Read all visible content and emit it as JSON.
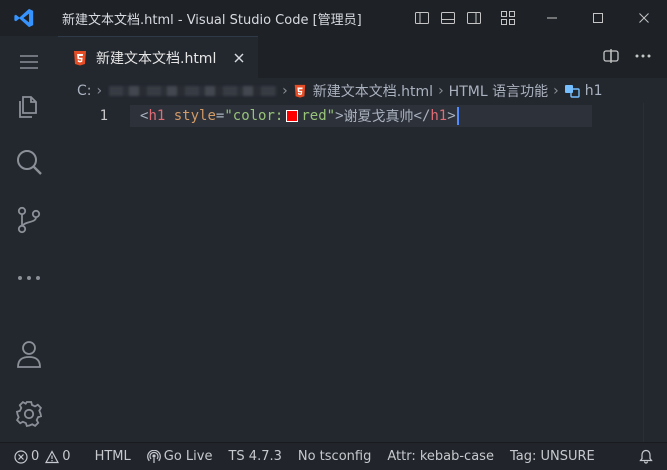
{
  "window": {
    "title": "新建文本文档.html - Visual Studio Code [管理员]"
  },
  "tab": {
    "label": "新建文本文档.html"
  },
  "breadcrumb": {
    "drive": "C:",
    "file": "新建文本文档.html",
    "language": "HTML 语言功能",
    "symbol": "h1"
  },
  "editor": {
    "line_number": "1",
    "tokens": {
      "open_lt": "<",
      "tag_open": "h1",
      "attr_name": "style",
      "equals": "=",
      "quote_open": "\"",
      "attr_value_prefix": "color:",
      "attr_value_color": "red",
      "quote_close": "\"",
      "open_gt": ">",
      "text": "谢夏戈真帅",
      "close_lt": "</",
      "tag_close": "h1",
      "close_gt": ">"
    },
    "swatch_color": "#ff0000"
  },
  "statusbar": {
    "errors": "0",
    "warnings": "0",
    "language": "HTML",
    "golive": "Go Live",
    "ts_version": "TS 4.7.3",
    "tsconfig": "No tsconfig",
    "attr": "Attr: kebab-case",
    "tag": "Tag: UNSURE"
  },
  "colors": {
    "accent": "#3794ff",
    "html_icon": "#e44d26",
    "tag": "#e06c75",
    "attribute": "#d19a66",
    "string": "#98c379"
  },
  "icons": {
    "app": "vscode-logo-icon",
    "activity": [
      "menu-icon",
      "explorer-icon",
      "search-icon",
      "source-control-icon",
      "more-icon",
      "account-icon",
      "settings-icon"
    ],
    "titlebar": [
      "toggle-sidebar-icon",
      "toggle-panel-icon",
      "toggle-secondary-sidebar-icon",
      "customize-layout-icon",
      "minimize-icon",
      "maximize-icon",
      "close-icon"
    ],
    "tab_actions": [
      "split-editor-icon",
      "more-actions-icon"
    ]
  }
}
